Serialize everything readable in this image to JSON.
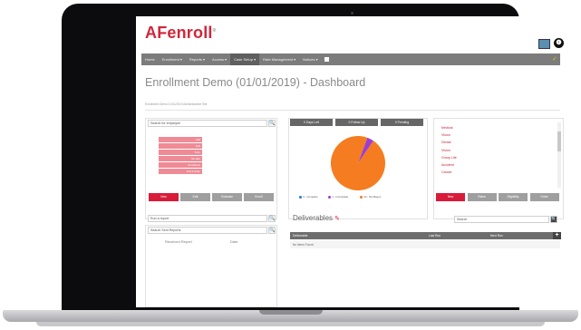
{
  "app": {
    "logo": "AFenroll",
    "logo_mark": "®",
    "header_icons": [
      "presentation-icon",
      "info-icon"
    ],
    "info_glyph": "❶"
  },
  "nav": {
    "items": [
      "Home",
      "Enrollment ▾",
      "Reports ▾",
      "Access ▾",
      "Case Setup ▾",
      "Rate Management ▾",
      "Notices ▾"
    ],
    "active_index": 4,
    "check_glyph": "✓"
  },
  "page": {
    "title": "Enrollment Demo (01/01/2019) - Dashboard",
    "subtitle": "Enrollment Demo 01/01/2019 Administrative Site"
  },
  "left_panel": {
    "search_placeholder": "Search for employee",
    "search_glyph": "🔍",
    "bars": [
      "Add",
      "Edit",
      "Term",
      "Re-Hire",
      "Enrollment",
      "Enroll Other"
    ],
    "buttons": [
      "New",
      "Edit",
      "Estimate",
      "Enroll"
    ]
  },
  "center_panel": {
    "tabs": [
      "0 Days Left",
      "0 Follow Up",
      "0 Pending"
    ],
    "chart_data": {
      "type": "pie",
      "series": [
        {
          "name": "0 - Complete",
          "value": 0,
          "color": "#2979c9"
        },
        {
          "name": "1 - Incomplete",
          "value": 1,
          "color": "#9b3fd1"
        },
        {
          "name": "24 - Not Begun",
          "value": 24,
          "color": "#f57c20"
        }
      ],
      "legend_position": "bottom"
    }
  },
  "right_panel": {
    "items": [
      "Medical",
      "Vision",
      "Dental",
      "Vision",
      "Group Life",
      "Accident",
      "Cancer"
    ],
    "buttons": [
      "New",
      "Rates",
      "Eligibility",
      "Order"
    ]
  },
  "reports_panel": {
    "run_placeholder": "Run a report",
    "search_sent_placeholder": "Search Sent Reports",
    "columns": [
      "Received Report",
      "Date"
    ]
  },
  "deliverables": {
    "title": "Deliverables",
    "edit_glyph": "✎",
    "search_placeholder": "Search",
    "columns": [
      "Deliverable",
      "Last Run",
      "Next Run"
    ],
    "empty_text": "No Items Found",
    "add_glyph": "+"
  }
}
